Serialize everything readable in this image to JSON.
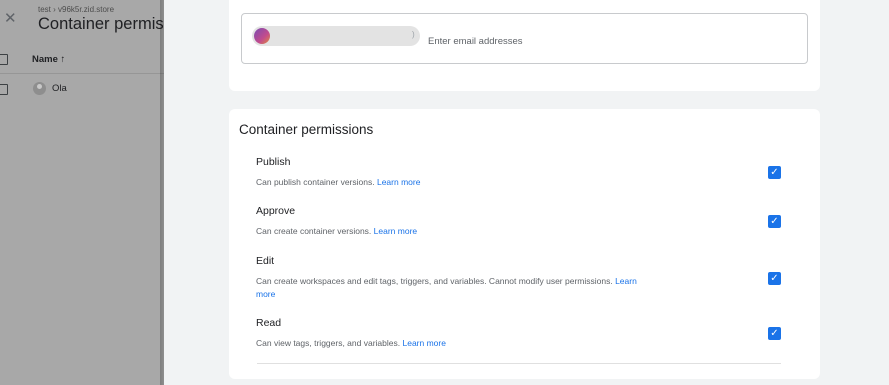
{
  "left_panel": {
    "breadcrumb": "test › v96k5r.zid.store",
    "title": "Container permiss",
    "column_header": "Name ↑",
    "users": [
      {
        "name": "Ola"
      }
    ]
  },
  "invite": {
    "placeholder": "Enter email addresses"
  },
  "permissions": {
    "title": "Container permissions",
    "items": [
      {
        "name": "Publish",
        "description": "Can publish container versions.",
        "learn_more": "Learn more",
        "checked": true
      },
      {
        "name": "Approve",
        "description": "Can create container versions.",
        "learn_more": "Learn more",
        "checked": true
      },
      {
        "name": "Edit",
        "description": "Can create workspaces and edit tags, triggers, and variables. Cannot modify user permissions.",
        "learn_more": "Learn more",
        "checked": true
      },
      {
        "name": "Read",
        "description": "Can view tags, triggers, and variables.",
        "learn_more": "Learn more",
        "checked": true
      }
    ]
  },
  "colors": {
    "accent": "#1a73e8",
    "overlay": "#a8a8a8",
    "background": "#f1f3f4"
  }
}
